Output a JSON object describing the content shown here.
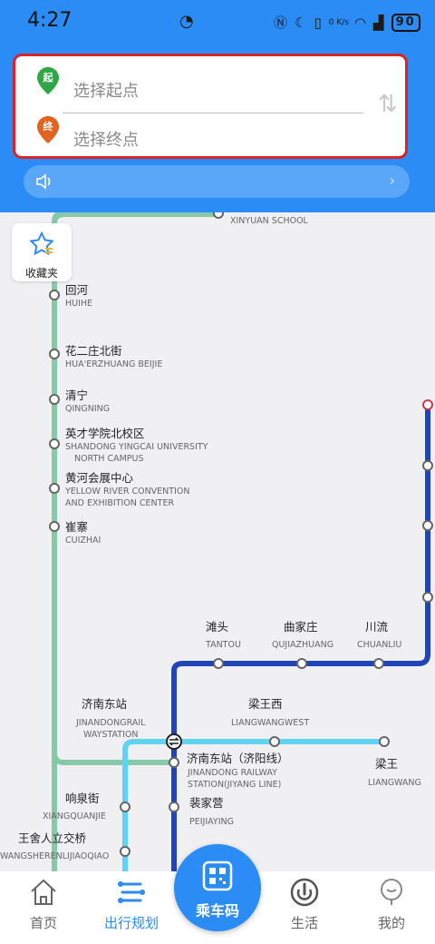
{
  "status": {
    "time": "4:27",
    "speed": "0 K/s",
    "battery": "90"
  },
  "route": {
    "start_badge": "起",
    "end_badge": "终",
    "start_placeholder": "选择起点",
    "end_placeholder": "选择终点",
    "swap_icon": "swap-vertical-icon"
  },
  "notice": {
    "icon": "speaker-icon"
  },
  "favorites": {
    "label": "收藏夹"
  },
  "stations": {
    "xinyuan": {
      "cn": "",
      "en": "XINYUAN SCHOOL"
    },
    "huihe": {
      "cn": "回河",
      "en": "HUIHE"
    },
    "huaer": {
      "cn": "花二庄北街",
      "en": "HUA'ERZHUANG BEIJIE"
    },
    "qingning": {
      "cn": "清宁",
      "en": "QINGNING"
    },
    "yingcai": {
      "cn": "英才学院北校区",
      "en1": "SHANDONG YINGCAI UNIVERSITY",
      "en2": "NORTH CAMPUS"
    },
    "huanghe": {
      "cn": "黄河会展中心",
      "en1": "YELLOW RIVER CONVENTION",
      "en2": "AND EXHIBITION CENTER"
    },
    "cuizhai": {
      "cn": "崔寨",
      "en": "CUIZHAI"
    },
    "tantou": {
      "cn": "滩头",
      "en": "TANTOU"
    },
    "qujiazhuang": {
      "cn": "曲家庄",
      "en": "QUJIAZHUANG"
    },
    "chuanliu": {
      "cn": "川流",
      "en": "CHUANLIU"
    },
    "jinandong": {
      "cn": "济南东站",
      "en1": "JINANDONGRAIL",
      "en2": "WAYSTATION"
    },
    "liangwangxi": {
      "cn": "梁王西",
      "en": "LIANGWANGWEST"
    },
    "jinandong_jy": {
      "cn": "济南东站（济阳线）",
      "en1": "JINANDONG RAILWAY",
      "en2": "STATION(JIYANG LINE)"
    },
    "liangwang": {
      "cn": "梁王",
      "en": "LIANGWANG"
    },
    "xiangquan": {
      "cn": "响泉街",
      "en": "XIANGQUANJIE"
    },
    "peijiaying": {
      "cn": "裴家营",
      "en": "PEIJIAYING"
    },
    "wangshe": {
      "cn": "王舍人立交桥",
      "en": "WANGSHERENLIJIAOQIAO"
    }
  },
  "lines": {
    "green": "#86c9a8",
    "navy": "#1f45b8",
    "cyan": "#5fd3ef"
  },
  "tabs": [
    {
      "label": "首页",
      "icon": "home-icon"
    },
    {
      "label": "出行规划",
      "icon": "route-plan-icon"
    },
    {
      "label": "乘车码",
      "icon": "qr-code-icon"
    },
    {
      "label": "生活",
      "icon": "life-icon"
    },
    {
      "label": "我的",
      "icon": "profile-icon"
    }
  ]
}
